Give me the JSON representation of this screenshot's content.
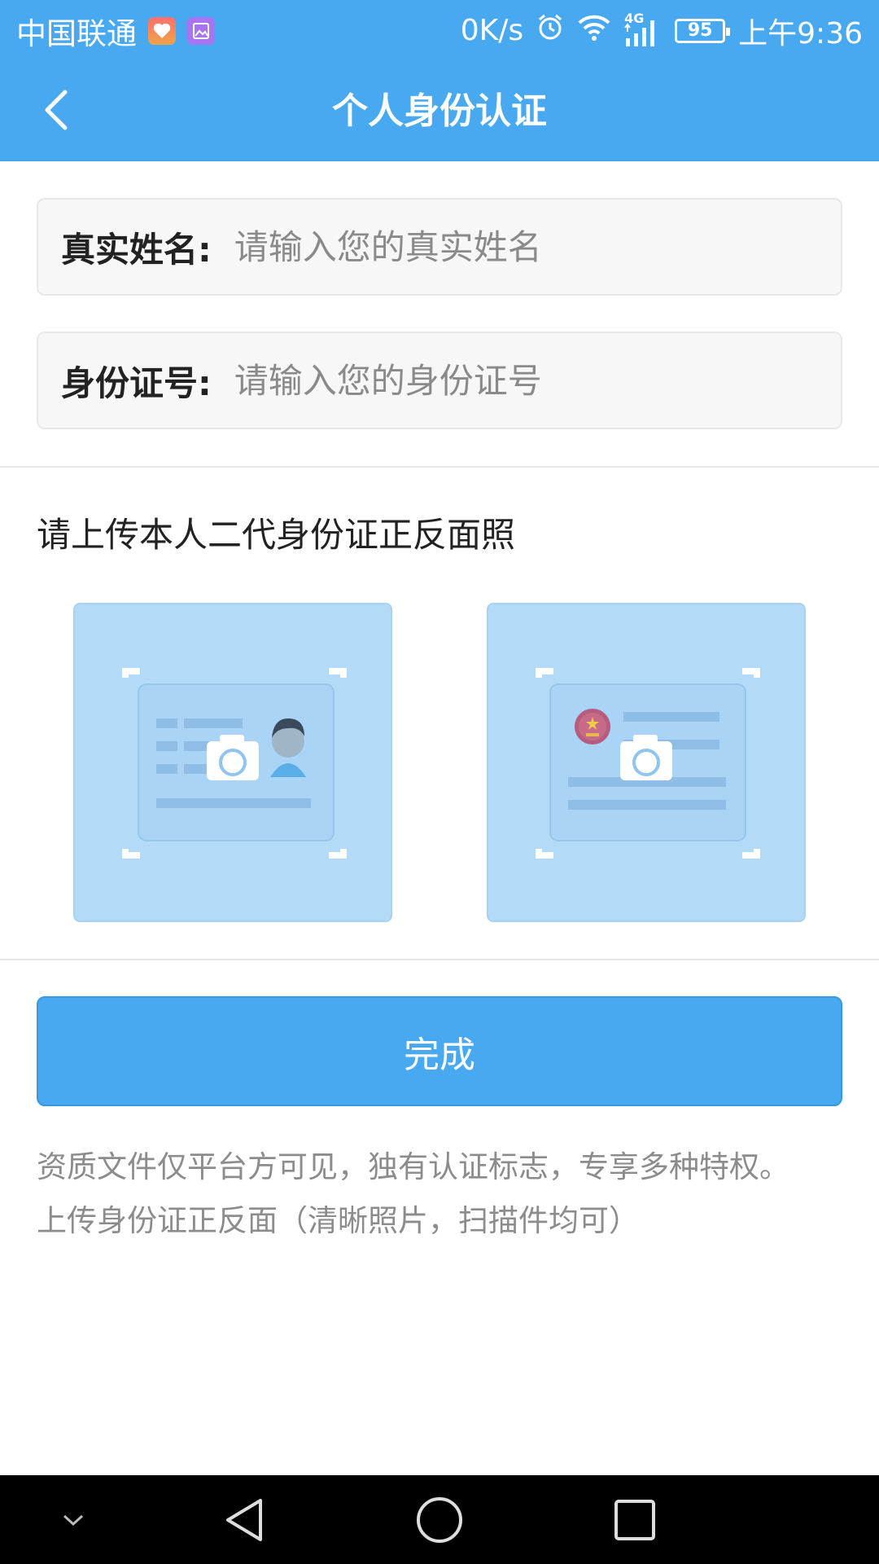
{
  "status_bar": {
    "carrier": "中国联通",
    "network_speed": "0K/s",
    "signal_type": "4G",
    "battery": "95",
    "time": "上午9:36"
  },
  "header": {
    "title": "个人身份认证",
    "back_icon": "chevron-left-icon"
  },
  "form": {
    "name_field": {
      "label": "真实姓名:",
      "placeholder": "请输入您的真实姓名",
      "value": ""
    },
    "id_field": {
      "label": "身份证号:",
      "placeholder": "请输入您的身份证号",
      "value": ""
    }
  },
  "upload": {
    "title": "请上传本人二代身份证正反面照",
    "front_icon": "id-card-front-camera-icon",
    "back_icon": "id-card-back-camera-icon"
  },
  "submit_label": "完成",
  "notes": [
    "资质文件仅平台方可见，独有认证标志，专享多种特权。",
    "上传身份证正反面（清晰照片，扫描件均可）"
  ],
  "colors": {
    "primary": "#48a9f0",
    "upload_bg": "#b3dbf7",
    "note_text": "#8c8c8c"
  }
}
